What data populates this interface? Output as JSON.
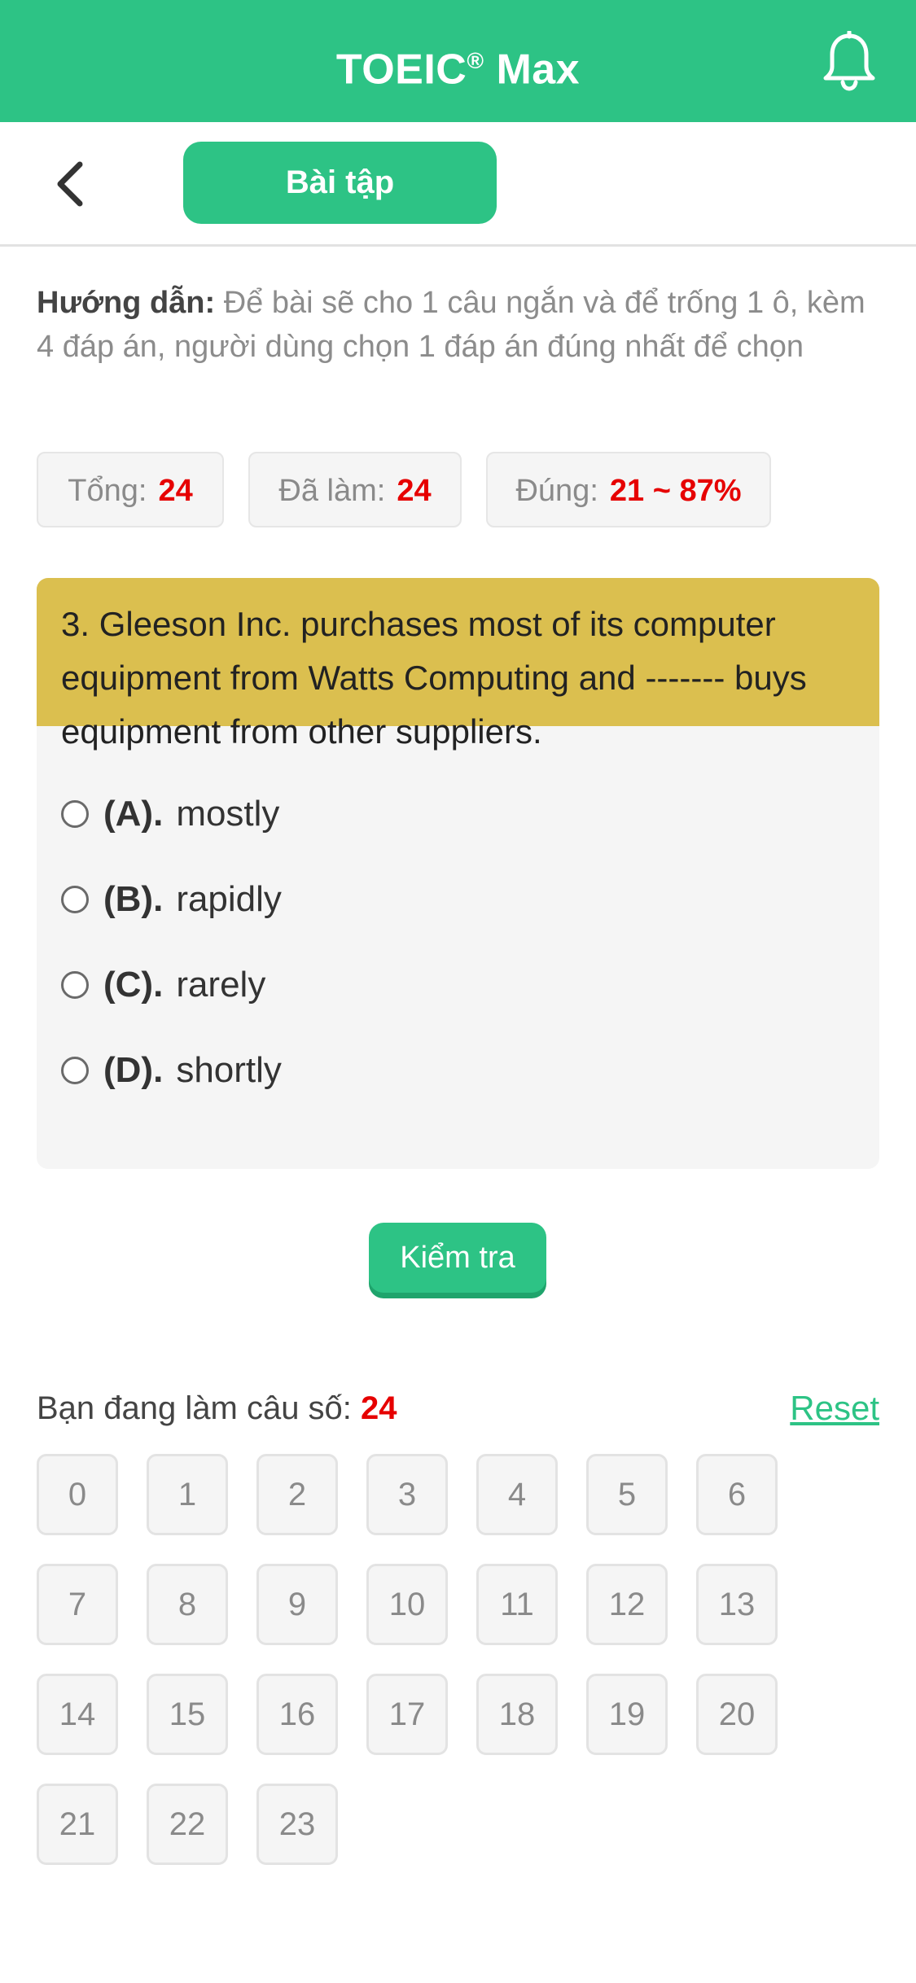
{
  "header": {
    "app_name": "TOEIC",
    "trademark": "®",
    "app_suffix": " Max",
    "bell_icon": "bell-icon"
  },
  "nav": {
    "back_icon": "chevron-left-icon",
    "tab_label": "Bài tập"
  },
  "instructions": {
    "label": "Hướng dẫn:",
    "text": " Để bài sẽ cho 1 câu ngắn và để trống 1 ô, kèm 4 đáp án, người dùng chọn 1 đáp án đúng nhất để chọn"
  },
  "stats": [
    {
      "label": "Tổng:",
      "value": "24"
    },
    {
      "label": "Đã làm:",
      "value": "24"
    },
    {
      "label": "Đúng:",
      "value": "21 ~ 87%"
    }
  ],
  "question": {
    "text": "3. Gleeson Inc. purchases most of its computer equipment from Watts Computing and ------- buys equipment from other suppliers.",
    "options": [
      {
        "letter": "(A).",
        "text": "mostly"
      },
      {
        "letter": "(B).",
        "text": "rapidly"
      },
      {
        "letter": "(C).",
        "text": "rarely"
      },
      {
        "letter": "(D).",
        "text": "shortly"
      }
    ]
  },
  "check_button": "Kiểm tra",
  "progress": {
    "label": "Bạn đang làm câu số: ",
    "current": "24",
    "reset_label": "Reset"
  },
  "question_numbers": [
    "0",
    "1",
    "2",
    "3",
    "4",
    "5",
    "6",
    "7",
    "8",
    "9",
    "10",
    "11",
    "12",
    "13",
    "14",
    "15",
    "16",
    "17",
    "18",
    "19",
    "20",
    "21",
    "22",
    "23"
  ],
  "colors": {
    "brand_green": "#2dc385",
    "question_header": "#dbbf4f",
    "highlight_red": "#e60000"
  }
}
